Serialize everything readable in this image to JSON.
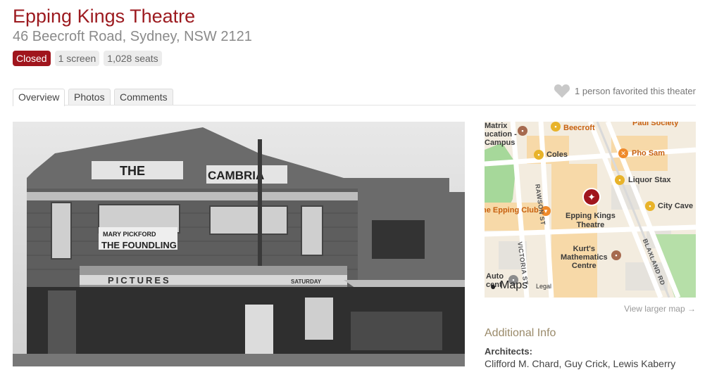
{
  "theater": {
    "name": "Epping Kings Theatre",
    "address": "46 Beecroft Road, Sydney, NSW 2121",
    "badges": {
      "status": "Closed",
      "screens": "1 screen",
      "seats": "1,028 seats"
    }
  },
  "tabs": [
    "Overview",
    "Photos",
    "Comments"
  ],
  "favorites": {
    "text": "1 person favorited this theater",
    "icon": "heart-icon"
  },
  "photo": {
    "signs": {
      "top_left": "THE",
      "top_right": "CAMBRIA",
      "sign1": "MARY PICKFORD",
      "sign2": "THE FOUNDLING",
      "awning": "PICTURES",
      "awning_right": "SATURDAY"
    }
  },
  "map": {
    "labels": {
      "matrix": "Matrix\nucation -\nCampus",
      "beecroft": "Beecroft",
      "paul": "Paul Society",
      "coles": "Coles",
      "pho": "Pho Sam",
      "liquor": "Liquor Stax",
      "city_cave": "City Cave",
      "epping_club": "he Epping Club",
      "epping_kings": "Epping Kings\nTheatre",
      "kurts": "Kurt's\nMathematics\nCentre",
      "rawson": "RAWSON ST",
      "victoria": "VICTORIA ST",
      "blaxland": "BLAXLAND RD",
      "auto": "Auto\ncent",
      "maps": "Maps",
      "legal": "Legal"
    },
    "view_larger": "View larger map →"
  },
  "additional_info": {
    "heading": "Additional Info",
    "architects_label": "Architects:",
    "architects_value": "Clifford M. Chard, Guy Crick, Lewis Kaberry"
  },
  "colors": {
    "brand": "#9c1a1f",
    "closed_badge": "#a0151d"
  }
}
